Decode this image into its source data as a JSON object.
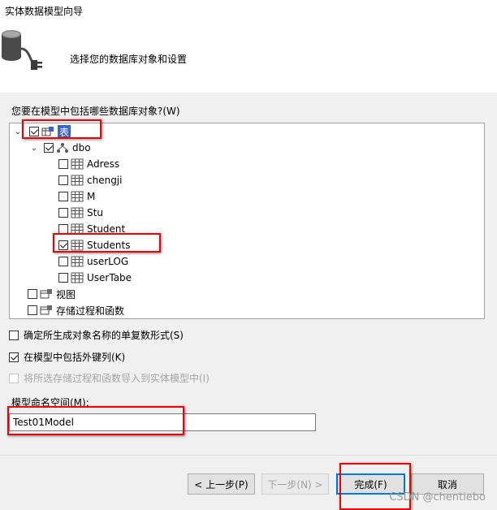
{
  "window": {
    "title": "实体数据模型向导"
  },
  "header": {
    "subtitle": "选择您的数据库对象和设置"
  },
  "question": "您要在模型中包括哪些数据库对象?(W)",
  "tree": {
    "root_label": "表",
    "schema_label": "dbo",
    "tables": [
      "Adress",
      "chengji",
      "M",
      "Stu",
      "Student",
      "Students",
      "userLOG",
      "UserTabe"
    ],
    "views_label": "视图",
    "procs_label": "存储过程和函数"
  },
  "options": {
    "pluralize": "确定所生成对象名称的单复数形式(S)",
    "foreign_keys": "在模型中包括外键列(K)",
    "import_procs": "将所选存储过程和函数导入到实体模型中(I)"
  },
  "namespace": {
    "label": "模型命名空间(M):",
    "value": "Test01Model"
  },
  "buttons": {
    "prev": "< 上一步(P)",
    "next": "下一步(N) >",
    "finish": "完成(F)",
    "cancel": "取消"
  },
  "watermark": "CSDN @chentiebo",
  "colors": {
    "highlight": "#e00000",
    "selection": "#3a64c8",
    "default_button_border": "#0078d7"
  }
}
